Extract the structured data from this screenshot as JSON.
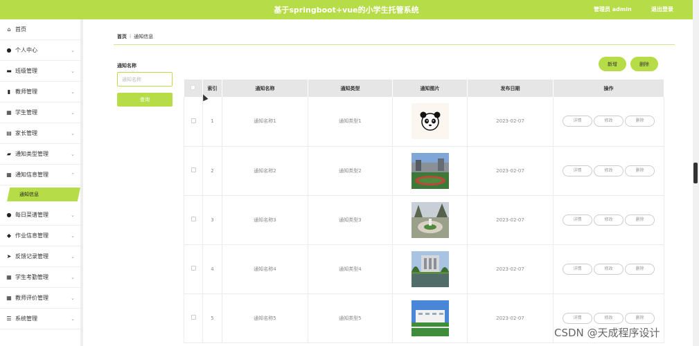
{
  "header": {
    "title": "基于springboot+vue的小学生托管系统",
    "admin": "管理员 admin",
    "logout": "退出登录"
  },
  "sidebar": {
    "items": [
      {
        "label": "首页",
        "icon": "home-icon"
      },
      {
        "label": "个人中心",
        "icon": "user-icon"
      },
      {
        "label": "班级管理",
        "icon": "briefcase-icon"
      },
      {
        "label": "教师管理",
        "icon": "clipboard-icon"
      },
      {
        "label": "学生管理",
        "icon": "grid-icon"
      },
      {
        "label": "家长管理",
        "icon": "id-card-icon"
      },
      {
        "label": "通知类型管理",
        "icon": "comment-icon"
      },
      {
        "label": "通知信息管理",
        "icon": "grid-icon"
      },
      {
        "label": "每日菜谱管理",
        "icon": "user-icon"
      },
      {
        "label": "作业信息管理",
        "icon": "pin-icon"
      },
      {
        "label": "反馈记录管理",
        "icon": "send-icon"
      },
      {
        "label": "学生考勤管理",
        "icon": "grid-icon"
      },
      {
        "label": "教师评价管理",
        "icon": "grid-icon"
      },
      {
        "label": "系统管理",
        "icon": "sliders-icon"
      }
    ],
    "active_sub": "通知信息"
  },
  "breadcrumb": {
    "home": "首页",
    "current": "通知信息"
  },
  "search": {
    "label": "通知名称",
    "placeholder": "通知名称",
    "button": "查询"
  },
  "actions": {
    "add": "新增",
    "delete": "删除"
  },
  "table": {
    "headers": [
      "索引",
      "通知名称",
      "通知类型",
      "通知图片",
      "发布日期",
      "操作"
    ],
    "rows": [
      {
        "index": "1",
        "name": "通知名称1",
        "type": "通知类型1",
        "date": "2023-02-07"
      },
      {
        "index": "2",
        "name": "通知名称2",
        "type": "通知类型2",
        "date": "2023-02-07"
      },
      {
        "index": "3",
        "name": "通知名称3",
        "type": "通知类型3",
        "date": "2023-02-07"
      },
      {
        "index": "4",
        "name": "通知名称4",
        "type": "通知类型4",
        "date": "2023-02-07"
      },
      {
        "index": "5",
        "name": "通知名称5",
        "type": "通知类型5",
        "date": "2023-02-07"
      }
    ],
    "op_labels": {
      "detail": "详情",
      "edit": "修改",
      "delete": "删除"
    }
  },
  "watermark": "CSDN @天成程序设计",
  "colors": {
    "accent": "#b6dc48"
  }
}
